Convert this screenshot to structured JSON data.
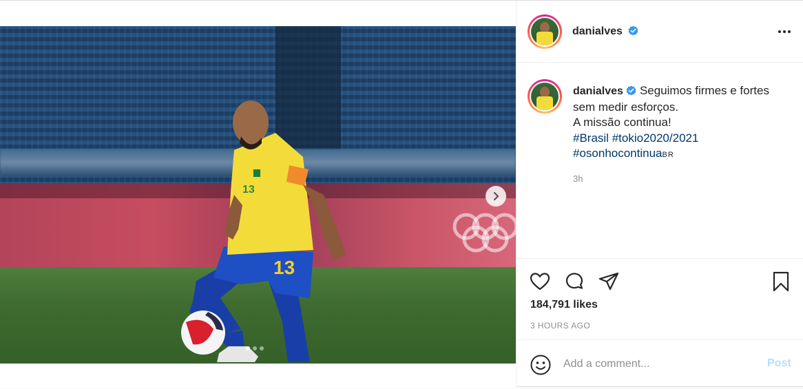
{
  "post": {
    "username": "danialves",
    "verified": true,
    "photo_count": 3,
    "active_photo": 1,
    "caption": {
      "username": "danialves",
      "line1": "Seguimos firmes e fortes",
      "line2": "sem medir esforços.",
      "line3": "A missão continua!",
      "hashtag1": "#Brasil",
      "hashtag2": "#tokio2020/2021",
      "hashtag3": "#osonhocontinua",
      "flag_text": "BR",
      "time": "3h"
    },
    "likes": "184,791 likes",
    "time_ago": "3 HOURS AGO",
    "comment": {
      "placeholder": "Add a comment...",
      "post_label": "Post"
    }
  },
  "icons": {
    "verified": "verified-badge-icon",
    "more": "more-options-icon",
    "like": "heart-icon",
    "comment": "comment-bubble-icon",
    "share": "paper-plane-icon",
    "save": "bookmark-icon",
    "emoji": "smiley-icon",
    "next": "chevron-right-icon"
  },
  "colors": {
    "accent": "#0095f6",
    "post_disabled": "#b2dffc",
    "link": "#00376b",
    "muted": "#8e8e8e",
    "text": "#262626"
  }
}
